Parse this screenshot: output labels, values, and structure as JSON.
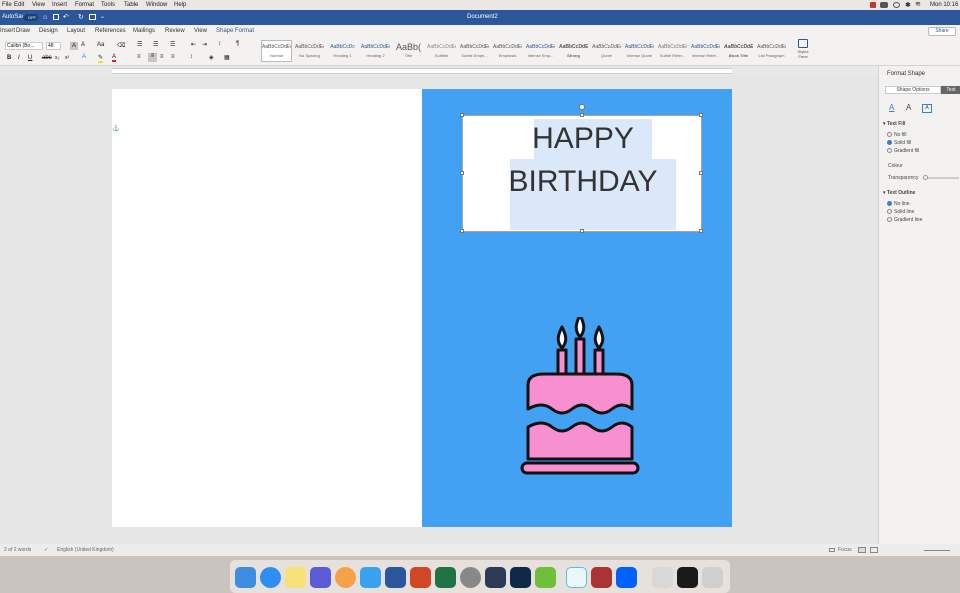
{
  "menubar": {
    "items": [
      "File",
      "Edit",
      "View",
      "Insert",
      "Format",
      "Tools",
      "Table",
      "Window",
      "Help"
    ],
    "clock": "Mon 10:16"
  },
  "titlebar": {
    "autosave": "AutoSave",
    "toggle": "OFF",
    "title": "Document2",
    "share": "Share"
  },
  "tabs": [
    "Insert",
    "Draw",
    "Design",
    "Layout",
    "References",
    "Mailings",
    "Review",
    "View",
    "Shape Format"
  ],
  "ribbon": {
    "font_name": "Calibri (Bo...",
    "font_size": "48",
    "styles": [
      {
        "sample": "AaBbCcDdEe",
        "name": "Normal"
      },
      {
        "sample": "AaBbCcDdEe",
        "name": "No Spacing"
      },
      {
        "sample": "AaBbCcDc",
        "name": "Heading 1"
      },
      {
        "sample": "AaBbCcDdEe",
        "name": "Heading 2"
      },
      {
        "sample": "AaBb(",
        "name": "Title"
      },
      {
        "sample": "AaBbCcDdEe",
        "name": "Subtitle"
      },
      {
        "sample": "AaBbCcDdEe",
        "name": "Subtle Emph..."
      },
      {
        "sample": "AaBbCcDdEe",
        "name": "Emphasis"
      },
      {
        "sample": "AaBbCcDdEe",
        "name": "Intense Emp..."
      },
      {
        "sample": "AaBbCcDdEe",
        "name": "Strong"
      },
      {
        "sample": "AaBbCcDdEe",
        "name": "Quote"
      },
      {
        "sample": "AaBbCcDdEe",
        "name": "Intense Quote"
      },
      {
        "sample": "AaBbCcDdEe",
        "name": "Subtle Refer..."
      },
      {
        "sample": "AaBbCcDdEe",
        "name": "Intense Refer..."
      },
      {
        "sample": "AaBbCcDdEe",
        "name": "Book Title"
      },
      {
        "sample": "AaBbCcDdEe",
        "name": "List Paragraph"
      }
    ],
    "styles_pane": "Styles Pane"
  },
  "card": {
    "line1": "HAPPY",
    "line2": "BIRTHDAY",
    "background_color": "#42a1f3",
    "cake_color": "#f78fd0"
  },
  "format_panel": {
    "title": "Format Shape",
    "tab_shape": "Shape Options",
    "tab_text": "Text",
    "text_fill_heading": "Text Fill",
    "fill_options": [
      "No fill",
      "Solid fill",
      "Gradient fill"
    ],
    "colour_label": "Colour",
    "transparency_label": "Transparency",
    "text_outline_heading": "Text Outline",
    "outline_options": [
      "No line",
      "Solid line",
      "Gradient line"
    ]
  },
  "status": {
    "words": "2 of 2 words",
    "language": "English (United Kingdom)",
    "focus": "Focus"
  }
}
